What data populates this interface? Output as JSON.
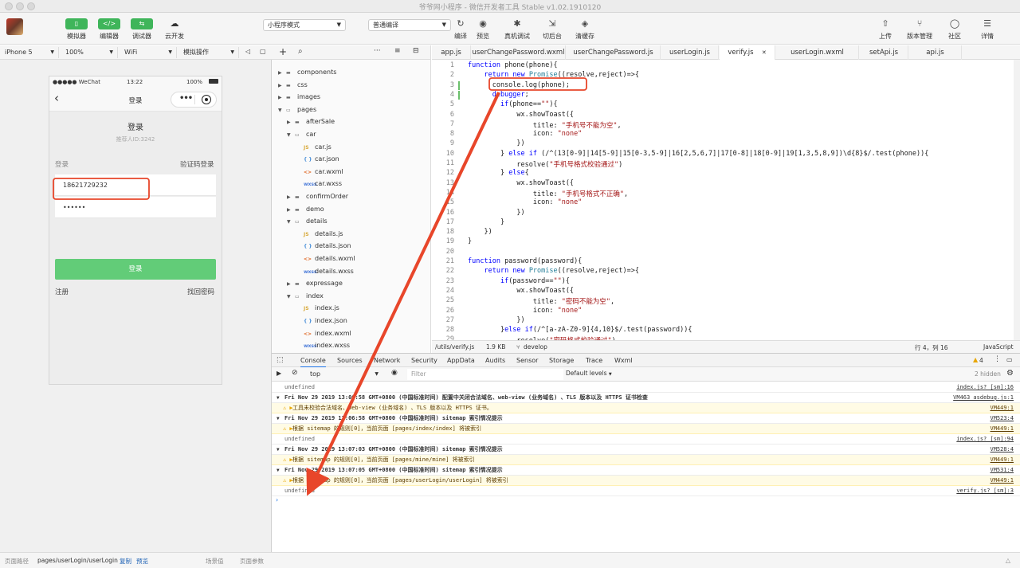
{
  "window": {
    "title": "爷爷网小程序 - 微信开发者工具 Stable v1.02.1910120"
  },
  "toolbar": {
    "left": [
      {
        "label": "模拟器",
        "icon": "phone-icon"
      },
      {
        "label": "编辑器",
        "icon": "code-icon"
      },
      {
        "label": "调试器",
        "icon": "swap-icon"
      },
      {
        "label": "云开发",
        "icon": "cloud-icon"
      }
    ],
    "mode_select": "小程序模式",
    "compile_select": "普通编译",
    "middle": [
      {
        "label": "编译",
        "icon": "refresh-icon"
      },
      {
        "label": "预览",
        "icon": "eye-icon"
      },
      {
        "label": "真机调试",
        "icon": "bug-icon"
      },
      {
        "label": "切后台",
        "icon": "background-icon"
      },
      {
        "label": "清缓存",
        "icon": "layers-icon"
      }
    ],
    "right": [
      {
        "label": "上传",
        "icon": "upload-icon"
      },
      {
        "label": "版本管理",
        "icon": "branch-icon"
      },
      {
        "label": "社区",
        "icon": "chat-icon"
      },
      {
        "label": "详情",
        "icon": "menu-icon"
      }
    ]
  },
  "simulator": {
    "device": "iPhone 5",
    "zoom": "100%",
    "network": "WiFi",
    "sim_op": "模拟操作",
    "phone": {
      "carrier": "●●●●● WeChat",
      "time": "13:22",
      "battery": "100%",
      "nav_title": "登录",
      "page_title": "登录",
      "subtitle": "推荐人ID:3242",
      "login_label": "登录",
      "sms_login": "验证码登录",
      "phone_value": "18621729232",
      "password_value": "••••••",
      "login_button": "登录",
      "register": "注册",
      "forgot": "找回密码"
    },
    "footer": {
      "path_label": "页面路径",
      "path": "pages/userLogin/userLogin",
      "copy": "复制",
      "preview": "预览",
      "scene": "场景值",
      "params": "页面参数"
    }
  },
  "tree": [
    {
      "name": "components",
      "type": "folder",
      "depth": 0,
      "open": false
    },
    {
      "name": "css",
      "type": "folder",
      "depth": 0,
      "open": false
    },
    {
      "name": "images",
      "type": "folder",
      "depth": 0,
      "open": false
    },
    {
      "name": "pages",
      "type": "folder",
      "depth": 0,
      "open": true
    },
    {
      "name": "afterSale",
      "type": "folder",
      "depth": 1,
      "open": false
    },
    {
      "name": "car",
      "type": "folder",
      "depth": 1,
      "open": true
    },
    {
      "name": "car.js",
      "type": "js",
      "depth": 2
    },
    {
      "name": "car.json",
      "type": "json",
      "depth": 2
    },
    {
      "name": "car.wxml",
      "type": "wxml",
      "depth": 2
    },
    {
      "name": "car.wxss",
      "type": "wxss",
      "depth": 2
    },
    {
      "name": "confirmOrder",
      "type": "folder",
      "depth": 1,
      "open": false
    },
    {
      "name": "demo",
      "type": "folder",
      "depth": 1,
      "open": false
    },
    {
      "name": "details",
      "type": "folder",
      "depth": 1,
      "open": true
    },
    {
      "name": "details.js",
      "type": "js",
      "depth": 2
    },
    {
      "name": "details.json",
      "type": "json",
      "depth": 2
    },
    {
      "name": "details.wxml",
      "type": "wxml",
      "depth": 2
    },
    {
      "name": "details.wxss",
      "type": "wxss",
      "depth": 2
    },
    {
      "name": "expressage",
      "type": "folder",
      "depth": 1,
      "open": false
    },
    {
      "name": "index",
      "type": "folder",
      "depth": 1,
      "open": true
    },
    {
      "name": "index.js",
      "type": "js",
      "depth": 2
    },
    {
      "name": "index.json",
      "type": "json",
      "depth": 2
    },
    {
      "name": "index.wxml",
      "type": "wxml",
      "depth": 2
    },
    {
      "name": "index.wxss",
      "type": "wxss",
      "depth": 2
    }
  ],
  "file_icons": {
    "js": "JS",
    "json": "{ }",
    "wxml": "<>",
    "wxss": "wxss"
  },
  "tabs": [
    {
      "label": "app.js",
      "active": false
    },
    {
      "label": "userChangePassword.wxml",
      "active": false
    },
    {
      "label": "userChangePassword.js",
      "active": false
    },
    {
      "label": "userLogin.js",
      "active": false
    },
    {
      "label": "verify.js",
      "active": true
    },
    {
      "label": "userLogin.wxml",
      "active": false
    },
    {
      "label": "setApi.js",
      "active": false
    },
    {
      "label": "api.js",
      "active": false
    }
  ],
  "code": [
    "function phone(phone){",
    "    return new Promise((resolve,reject)=>{",
    "      console.log(phone);",
    "      debugger;",
    "        if(phone==\"\"){",
    "            wx.showToast({",
    "                title: \"手机号不能为空\",",
    "                icon: \"none\"",
    "            })",
    "        } else if (/^(13[0-9]|14[5-9]|15[0-3,5-9]|16[2,5,6,7]|17[0-8]|18[0-9]|19[1,3,5,8,9])\\d{8}$/.test(phone)){",
    "            resolve(\"手机号格式校验通过\")",
    "        } else{",
    "            wx.showToast({",
    "                title: \"手机号格式不正确\",",
    "                icon: \"none\"",
    "            })",
    "        }",
    "    })",
    "}",
    "",
    "function password(password){",
    "    return new Promise((resolve,reject)=>{",
    "        if(password==\"\"){",
    "            wx.showToast({",
    "                title: \"密码不能为空\",",
    "                icon: \"none\"",
    "            })",
    "        }else if(/^[a-zA-Z0-9]{4,10}$/.test(password)){",
    "            resolve(\"密码格式校验通过\")"
  ],
  "editor_status": {
    "path": "/utils/verify.js",
    "size": "1.9 KB",
    "branch": "develop",
    "position": "行 4，列 16",
    "lang": "JavaScript"
  },
  "devtools": {
    "tabs": [
      "Console",
      "Sources",
      "Network",
      "Security",
      "AppData",
      "Audits",
      "Sensor",
      "Storage",
      "Trace",
      "Wxml"
    ],
    "active": "Console",
    "warn_count": "4",
    "context": "top",
    "filter_placeholder": "Filter",
    "levels": "Default levels",
    "hidden": "2 hidden"
  },
  "console_rows": [
    {
      "kind": "log",
      "text": "undefined",
      "src": "index.js? [sm]:16"
    },
    {
      "kind": "group",
      "text": "Fri Nov 29 2019 13:06:58 GMT+0800 (中国标准时间) 配置中关闭合法域名、web-view (业务域名) 、TLS 版本以及 HTTPS 证书检查",
      "src": "VM463 asdebug.js:1"
    },
    {
      "kind": "warn",
      "text": "工具未校验合法域名、web-view (业务域名) 、TLS 版本以及 HTTPS 证书。",
      "src": "VM449:1"
    },
    {
      "kind": "group",
      "text": "Fri Nov 29 2019 13:06:58 GMT+0800 (中国标准时间) sitemap 索引情况提示",
      "src": "VM523:4"
    },
    {
      "kind": "warn",
      "text": "根据 sitemap 的规则[0]，当前页面 [pages/index/index] 将被索引",
      "src": "VM449:1"
    },
    {
      "kind": "log",
      "text": "undefined",
      "src": "index.js? [sm]:94"
    },
    {
      "kind": "group",
      "text": "Fri Nov 29 2019 13:07:03 GMT+0800 (中国标准时间) sitemap 索引情况提示",
      "src": "VM528:4"
    },
    {
      "kind": "warn",
      "text": "根据 sitemap 的规则[0]，当前页面 [pages/mine/mine] 将被索引",
      "src": "VM449:1"
    },
    {
      "kind": "group",
      "text": "Fri Nov 29 2019 13:07:05 GMT+0800 (中国标准时间) sitemap 索引情况提示",
      "src": "VM531:4"
    },
    {
      "kind": "warn",
      "text": "根据 sitemap 的规则[0]，当前页面 [pages/userLogin/userLogin] 将被索引",
      "src": "VM449:1"
    },
    {
      "kind": "log",
      "text": "undefined",
      "src": "verify.js? [sm]:3"
    }
  ],
  "colors": {
    "accent": "#3fb55a",
    "annotation": "#e8462a",
    "keyword": "#0000ff",
    "string": "#a31515",
    "button": "#62cc78"
  }
}
